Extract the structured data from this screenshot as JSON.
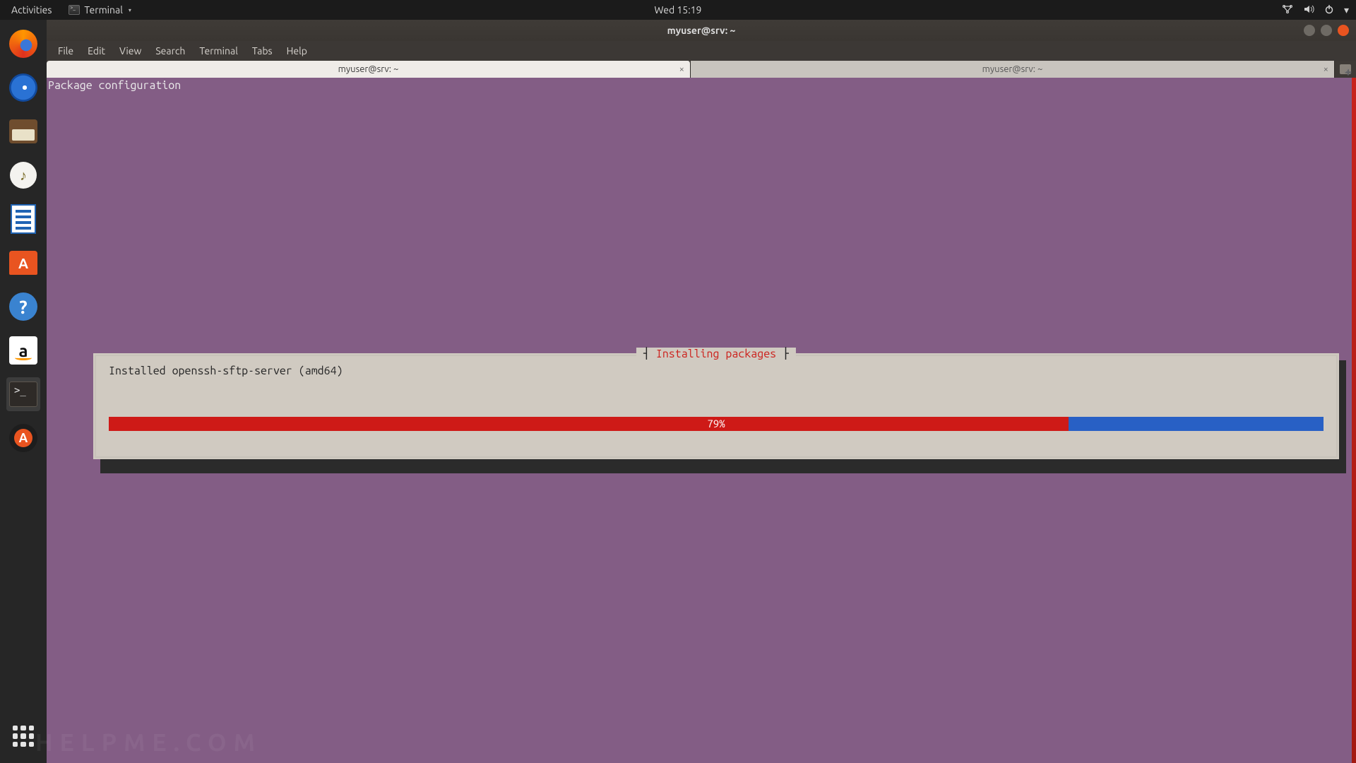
{
  "top_panel": {
    "activities": "Activities",
    "app_menu_label": "Terminal",
    "clock": "Wed 15:19",
    "sys_icons": {
      "network": "network-icon",
      "sound": "sound-icon",
      "power": "power-icon",
      "caret": "▾"
    }
  },
  "window": {
    "title": "myuser@srv: ~"
  },
  "menubar": {
    "items": [
      "File",
      "Edit",
      "View",
      "Search",
      "Terminal",
      "Tabs",
      "Help"
    ]
  },
  "tabs": {
    "active_label": "myuser@srv: ~",
    "inactive_label": "myuser@srv: ~",
    "close_glyph": "×"
  },
  "terminal": {
    "header_line": "Package configuration",
    "dialog_title": "Installing packages",
    "status_line": "Installed openssh-sftp-server (amd64)",
    "progress_percent": 79,
    "progress_label": "79%"
  },
  "dock": {
    "items": [
      {
        "name": "firefox-icon"
      },
      {
        "name": "thunderbird-icon"
      },
      {
        "name": "files-icon"
      },
      {
        "name": "rhythmbox-icon"
      },
      {
        "name": "writer-icon"
      },
      {
        "name": "software-icon"
      },
      {
        "name": "help-icon"
      },
      {
        "name": "amazon-icon"
      },
      {
        "name": "terminal-icon",
        "running": true
      },
      {
        "name": "updater-icon"
      }
    ],
    "apps_button": "show-apps-icon"
  },
  "watermark": "HELPME.COM"
}
